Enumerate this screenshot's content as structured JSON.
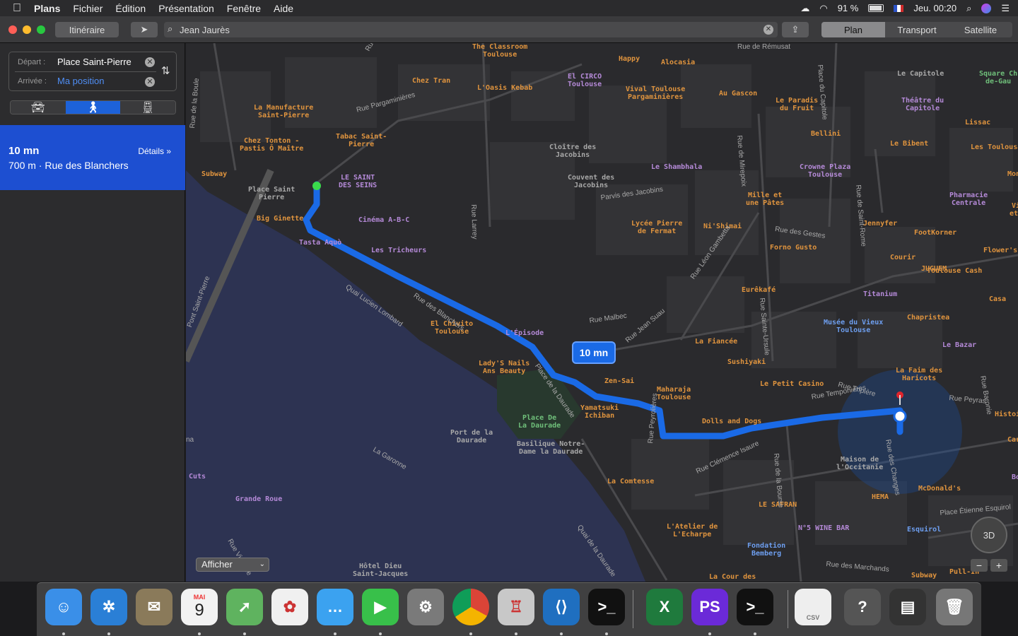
{
  "menubar": {
    "app_name": "Plans",
    "menus": [
      "Fichier",
      "Édition",
      "Présentation",
      "Fenêtre",
      "Aide"
    ],
    "battery": "91 %",
    "clock": "Jeu. 00:20"
  },
  "toolbar": {
    "itinerary_button": "Itinéraire",
    "search_value": "Jean Jaurès",
    "map_modes": [
      "Plan",
      "Transport",
      "Satellite"
    ],
    "active_map_mode": "Plan"
  },
  "sidebar": {
    "depart_label": "Départ :",
    "depart_value": "Place Saint-Pierre",
    "arrival_label": "Arrivée :",
    "arrival_value": "Ma position",
    "transport_modes": [
      "car-icon",
      "walk-icon",
      "transit-icon"
    ],
    "active_transport": "walk-icon",
    "result_time": "10 mn",
    "result_details": "Détails »",
    "result_summary": "700 m · Rue des Blanchers"
  },
  "map": {
    "eta_badge": "10 mn",
    "show_menu": "Afficher",
    "compass_label": "3D",
    "zoom_out": "−",
    "zoom_in": "+",
    "route_color": "#1a6ae6",
    "poi": [
      {
        "t": "The Classroom\nToulouse",
        "c": "orange"
      },
      {
        "t": "Happy",
        "c": "orange"
      },
      {
        "t": "Alocasia",
        "c": "orange"
      },
      {
        "t": "Chez Tran",
        "c": "orange"
      },
      {
        "t": "L'Oasis Kebab",
        "c": "orange"
      },
      {
        "t": "El CIRCO\nToulouse",
        "c": "purple"
      },
      {
        "t": "Vival Toulouse\nPargaminières",
        "c": "orange"
      },
      {
        "t": "Au Gascon",
        "c": "orange"
      },
      {
        "t": "Le Paradis\ndu Fruit",
        "c": "orange"
      },
      {
        "t": "Le Capitole",
        "c": "gray"
      },
      {
        "t": "Théâtre du\nCapitole",
        "c": "purple"
      },
      {
        "t": "La Manufacture\nSaint-Pierre",
        "c": "orange"
      },
      {
        "t": "Tabac Saint-\nPierre",
        "c": "orange"
      },
      {
        "t": "Chez Tonton -\nPastis Ô Maître",
        "c": "orange"
      },
      {
        "t": "Subway",
        "c": "orange"
      },
      {
        "t": "Place Saint\nPierre",
        "c": "gray"
      },
      {
        "t": "LE SAINT\nDES SEINS",
        "c": "purple"
      },
      {
        "t": "Cloître des\nJacobins",
        "c": "gray"
      },
      {
        "t": "Couvent des\nJacobins",
        "c": "gray"
      },
      {
        "t": "Le Shambhala",
        "c": "purple"
      },
      {
        "t": "Bellini",
        "c": "orange"
      },
      {
        "t": "Crowne Plaza\nToulouse",
        "c": "purple"
      },
      {
        "t": "Le Bibent",
        "c": "orange"
      },
      {
        "t": "Les Toulousains",
        "c": "orange"
      },
      {
        "t": "Lissac",
        "c": "orange"
      },
      {
        "t": "Big Ginette",
        "c": "orange"
      },
      {
        "t": "Cinéma A-B-C",
        "c": "purple"
      },
      {
        "t": "Tasta Aquò",
        "c": "purple"
      },
      {
        "t": "Mille et\nune Pâtes",
        "c": "orange"
      },
      {
        "t": "Pharmacie\nCentrale",
        "c": "purple"
      },
      {
        "t": "Lycée Pierre\nde Fermat",
        "c": "orange"
      },
      {
        "t": "Ni'Shimai",
        "c": "orange"
      },
      {
        "t": "Jennyfer",
        "c": "orange"
      },
      {
        "t": "FootKorner",
        "c": "orange"
      },
      {
        "t": "Les Tricheurs",
        "c": "purple"
      },
      {
        "t": "Forno Gusto",
        "c": "orange"
      },
      {
        "t": "Toulouse Cash",
        "c": "orange"
      },
      {
        "t": "Courir",
        "c": "orange"
      },
      {
        "t": "JUGUEM",
        "c": "orange"
      },
      {
        "t": "Flower's",
        "c": "orange"
      },
      {
        "t": "Eurêkafé",
        "c": "orange"
      },
      {
        "t": "Titanium",
        "c": "purple"
      },
      {
        "t": "Casa",
        "c": "orange"
      },
      {
        "t": "El Chivito\nToulouse",
        "c": "orange"
      },
      {
        "t": "L'Épisode",
        "c": "purple"
      },
      {
        "t": "Musée du Vieux\nToulouse",
        "c": "blue"
      },
      {
        "t": "Chapristea",
        "c": "orange"
      },
      {
        "t": "Lady'S Nails\nAns Beauty",
        "c": "orange"
      },
      {
        "t": "La Fiancée",
        "c": "orange"
      },
      {
        "t": "Le Bazar",
        "c": "purple"
      },
      {
        "t": "Sushiyaki",
        "c": "orange"
      },
      {
        "t": "La Faim des\nHaricots",
        "c": "orange"
      },
      {
        "t": "Zen-Sai",
        "c": "orange"
      },
      {
        "t": "Le Petit Casino",
        "c": "orange"
      },
      {
        "t": "Maharaja\nToulouse",
        "c": "orange"
      },
      {
        "t": "Yamatsuki\nIchiban",
        "c": "orange"
      },
      {
        "t": "Place De\nLa Daurade",
        "c": "green"
      },
      {
        "t": "Dolls and Dogs",
        "c": "orange"
      },
      {
        "t": "Histoire",
        "c": "orange"
      },
      {
        "t": "Port de la\nDaurade",
        "c": "gray"
      },
      {
        "t": "Basilique Notre-\nDame la Daurade",
        "c": "gray"
      },
      {
        "t": "Maison de\nl'Occitanie",
        "c": "gray"
      },
      {
        "t": "Carla",
        "c": "orange"
      },
      {
        "t": "La Comtesse",
        "c": "orange"
      },
      {
        "t": "Body",
        "c": "purple"
      },
      {
        "t": "McDonald's",
        "c": "orange"
      },
      {
        "t": "HEMA",
        "c": "orange"
      },
      {
        "t": "Cuts",
        "c": "purple"
      },
      {
        "t": "Grande Roue",
        "c": "purple"
      },
      {
        "t": "LE SAFRAN",
        "c": "orange"
      },
      {
        "t": "N°5 WINE BAR",
        "c": "purple"
      },
      {
        "t": "L'Atelier de\nL'Echarpe",
        "c": "orange"
      },
      {
        "t": "Esquirol",
        "c": "blue"
      },
      {
        "t": "Fondation\nBemberg",
        "c": "blue"
      },
      {
        "t": "Subway",
        "c": "orange"
      },
      {
        "t": "Pull-In",
        "c": "orange"
      },
      {
        "t": "Hôtel Dieu\nSaint-Jacques",
        "c": "gray"
      },
      {
        "t": "La Cour des",
        "c": "orange"
      },
      {
        "t": "Square Ch\nde-Gau",
        "c": "green"
      },
      {
        "t": "Mono",
        "c": "orange"
      },
      {
        "t": "Viol\net Pa",
        "c": "orange"
      }
    ],
    "streets": [
      "Rue",
      "Rue Pargaminières",
      "Rue de la Boule",
      "Place du Capitole",
      "Rue de Mirepoix",
      "Rue de Saint-Rome",
      "Parvis des Jacobins",
      "Rue des Gestes",
      "Rue Larrey",
      "Rue des Blanchers",
      "Quai Lucien Lombard",
      "Pont Saint-Pierre",
      "Rue Léon Gambetta",
      "Rue Sainte-Ursule",
      "Rue Malbec",
      "Rue Jean Suau",
      "Place de la Daurade",
      "Rue Tripière",
      "Rue Peyras",
      "Rue de la Bourse",
      "Rue Temponières",
      "Rue Peyrolières",
      "Rue Clémence Isaure",
      "Rue des Changes",
      "Quai de la Daurade",
      "La Garonne",
      "Rue Viguerie",
      "Place Étienne Esquirol",
      "Rue des Marchands",
      "Rue Baronie",
      "Rue de Rémusat",
      "na"
    ]
  },
  "dock": {
    "apps": [
      "finder-icon",
      "safari-icon",
      "preview-icon",
      "calendar-icon",
      "maps-icon",
      "photos-icon",
      "messages-icon",
      "facetime-icon",
      "system-preferences-icon",
      "chrome-icon",
      "tableplus-icon",
      "vscode-icon",
      "terminal-alt-icon",
      "excel-icon",
      "phpstorm-icon",
      "terminal-icon",
      "csv-file-icon",
      "help-icon",
      "console-icon",
      "trash-icon"
    ],
    "calendar_month": "MAI",
    "calendar_day": "9",
    "csv_label": "CSV"
  }
}
